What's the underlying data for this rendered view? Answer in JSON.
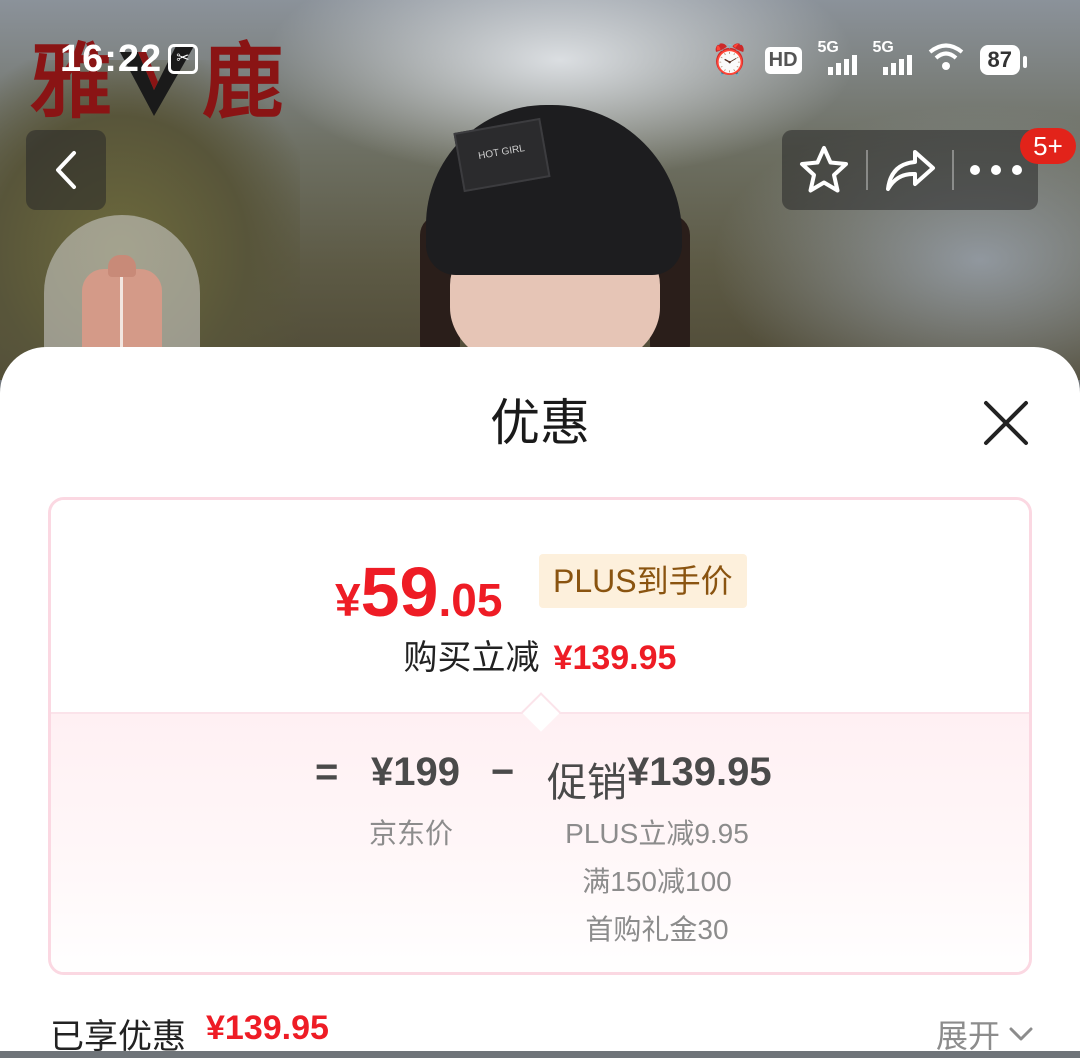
{
  "status_bar": {
    "time": "16:22",
    "hd_label": "HD",
    "sim1_label": "5G",
    "sim2_label": "5G",
    "battery": "87"
  },
  "background": {
    "brand_logo_text_1": "雅",
    "brand_logo_text_2": "鹿",
    "hat_label": "HOT GIRL"
  },
  "top_nav": {
    "back_icon": "chevron-left-icon",
    "favorite_icon": "star-icon",
    "share_icon": "share-icon",
    "more_icon": "more-icon",
    "message_badge": "5+"
  },
  "sheet": {
    "title": "优惠",
    "close_icon": "close-icon"
  },
  "price_card": {
    "currency": "¥",
    "price_integer": "59",
    "price_decimal": ".05",
    "price_tag": "PLUS到手价",
    "reduce_label": "购买立减",
    "reduce_amount": "¥139.95",
    "equals_sign": "=",
    "base_price": "¥199",
    "base_price_label": "京东价",
    "minus_sign": "−",
    "promo_label": "促销",
    "promo_amount": "¥139.95",
    "promo_details": [
      "PLUS立减9.95",
      "满150减100",
      "首购礼金30"
    ]
  },
  "summary": {
    "enjoyed_label": "已享优惠",
    "enjoyed_amount": "¥139.95",
    "expand_label": "展开",
    "expand_icon": "chevron-down-icon"
  },
  "colors": {
    "accent_red": "#ee1c25",
    "plus_tag_bg": "#fdf0dc",
    "plus_tag_text": "#8a5410",
    "card_border": "#fbd8e2"
  }
}
